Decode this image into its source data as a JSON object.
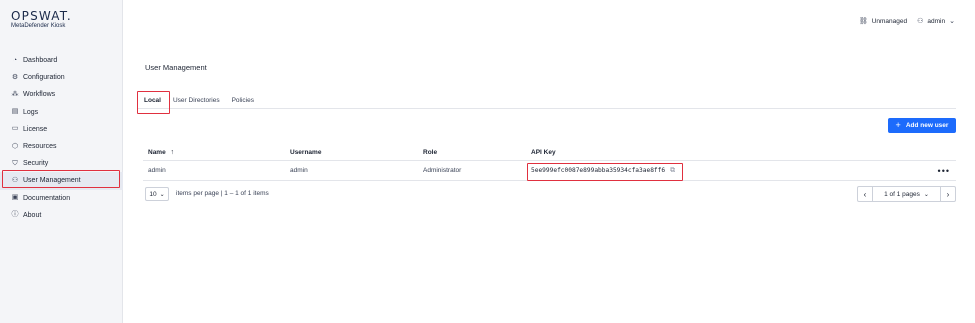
{
  "brand": {
    "logo": "OPSWAT.",
    "product": "MetaDefender Kiosk"
  },
  "sidebar": {
    "items": [
      {
        "label": "Dashboard",
        "icon": "dashboard-icon"
      },
      {
        "label": "Configuration",
        "icon": "configuration-icon"
      },
      {
        "label": "Workflows",
        "icon": "workflows-icon"
      },
      {
        "label": "Logs",
        "icon": "logs-icon"
      },
      {
        "label": "License",
        "icon": "license-icon"
      },
      {
        "label": "Resources",
        "icon": "resources-icon"
      },
      {
        "label": "Security",
        "icon": "security-icon"
      },
      {
        "label": "User Management",
        "icon": "user-management-icon",
        "active": true
      },
      {
        "label": "Documentation",
        "icon": "documentation-icon"
      },
      {
        "label": "About",
        "icon": "about-icon"
      }
    ]
  },
  "topbar": {
    "status": "Unmanaged",
    "user": "admin"
  },
  "page": {
    "title": "User Management"
  },
  "tabs": [
    {
      "label": "Local",
      "active": true
    },
    {
      "label": "User Directories"
    },
    {
      "label": "Policies"
    }
  ],
  "actions": {
    "add_user": "Add new user"
  },
  "table": {
    "columns": [
      "Name",
      "Username",
      "Role",
      "API Key"
    ],
    "rows": [
      {
        "name": "admin",
        "username": "admin",
        "role": "Administrator",
        "api_key": "5ee999efc0087e899abba35934cfa3ae8ff6"
      }
    ]
  },
  "pagination": {
    "page_size": "10",
    "items_text": "items per page  |  1 – 1 of 1 items",
    "pages_text": "1 of 1 pages"
  },
  "colors": {
    "accent": "#1d6bfc",
    "highlight": "#e0303f"
  }
}
